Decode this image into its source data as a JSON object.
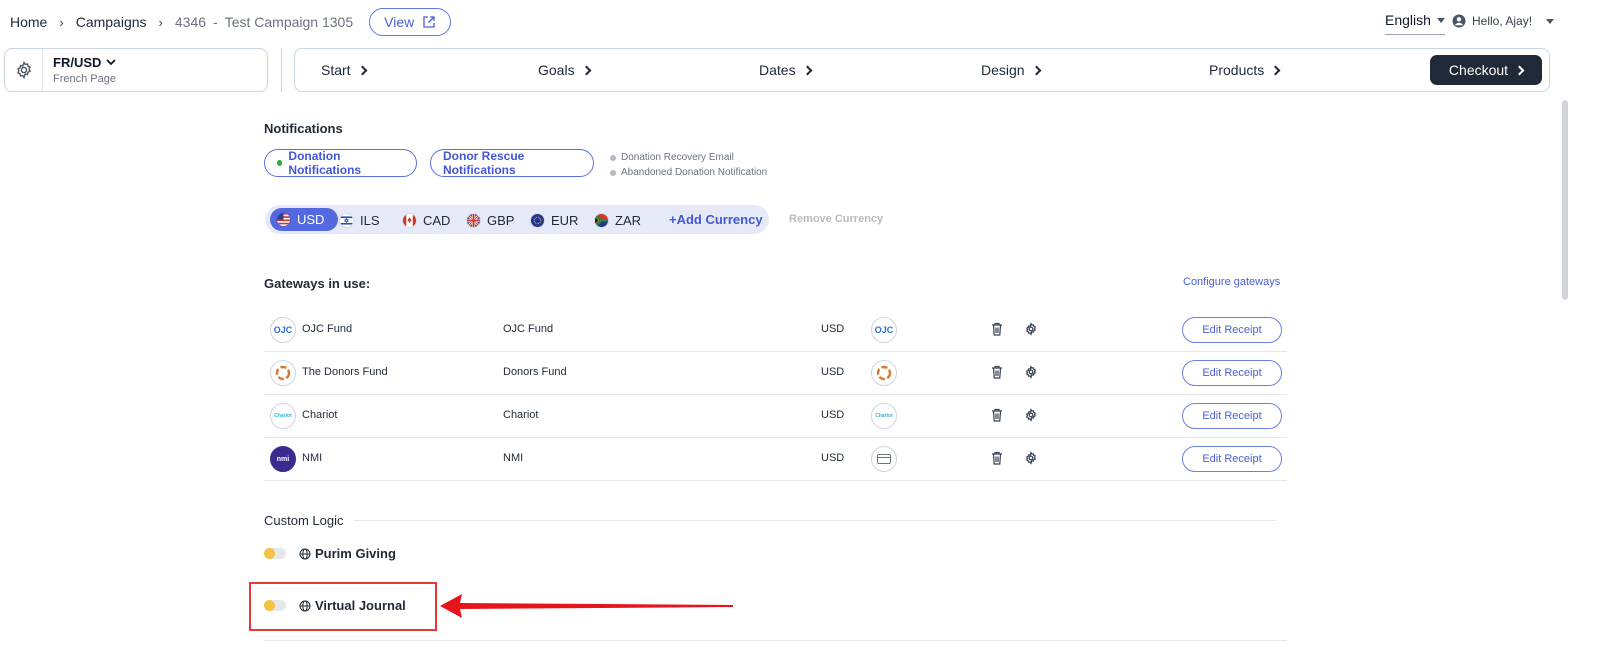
{
  "breadcrumb": {
    "home": "Home",
    "campaigns": "Campaigns",
    "campaign_id": "4346",
    "campaign_name": "Test Campaign 1305",
    "view_label": "View"
  },
  "header": {
    "language": "English",
    "greeting": "Hello, Ajay!"
  },
  "page_switch": {
    "current": "FR/USD",
    "subtitle": "French Page"
  },
  "steps": {
    "start": "Start",
    "goals": "Goals",
    "dates": "Dates",
    "design": "Design",
    "products": "Products",
    "checkout": "Checkout"
  },
  "notifications": {
    "title": "Notifications",
    "donation_notifications": "Donation Notifications",
    "donor_rescue_notifications": "Donor Rescue Notifications",
    "legend_recovery": "Donation Recovery Email",
    "legend_abandoned": "Abandoned Donation Notification"
  },
  "currencies": {
    "items": [
      "USD",
      "ILS",
      "CAD",
      "GBP",
      "EUR",
      "ZAR"
    ],
    "active": "USD",
    "add_label": "+Add Currency",
    "remove_label": "Remove Currency"
  },
  "gateways": {
    "title": "Gateways in use:",
    "configure_label": "Configure gateways",
    "edit_label": "Edit Receipt",
    "rows": [
      {
        "name": "OJC Fund",
        "display_name": "OJC Fund",
        "currency": "USD",
        "logo": "OJC"
      },
      {
        "name": "The Donors Fund",
        "display_name": "Donors Fund",
        "currency": "USD",
        "logo": "TDF"
      },
      {
        "name": "Chariot",
        "display_name": "Chariot",
        "currency": "USD",
        "logo": "Chariot"
      },
      {
        "name": "NMI",
        "display_name": "NMI",
        "currency": "USD",
        "logo": "nmi"
      }
    ]
  },
  "custom_logic": {
    "title": "Custom Logic",
    "items": [
      {
        "label": "Purim Giving"
      },
      {
        "label": "Virtual Journal"
      }
    ]
  },
  "colors": {
    "accent": "#4a5fd6",
    "dark": "#1f2937",
    "toggle_knob": "#f5c242",
    "highlight": "#e53935"
  }
}
